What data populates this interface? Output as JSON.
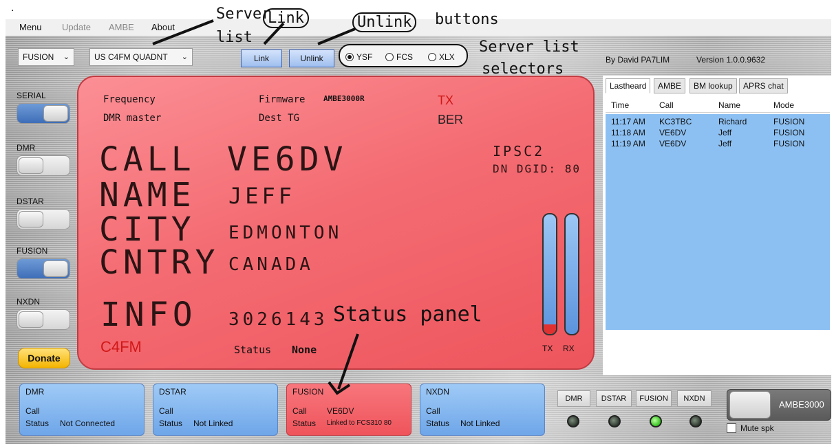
{
  "menu": {
    "items": [
      "Menu",
      "Update",
      "AMBE",
      "About"
    ]
  },
  "annotations": {
    "server_list": "Server",
    "server_list_2": "list",
    "link_box": "Link",
    "unlink_box": "Unlink",
    "buttons": "buttons",
    "selectors_1": "Server list",
    "selectors_2": "selectors",
    "status_panel": "Status panel"
  },
  "toolbar": {
    "mode": "FUSION",
    "server": "US C4FM QUADNT",
    "link_label": "Link",
    "unlink_label": "Unlink",
    "radios": [
      {
        "label": "YSF",
        "selected": true
      },
      {
        "label": "FCS",
        "selected": false
      },
      {
        "label": "XLX",
        "selected": false
      }
    ],
    "author": "By David PA7LIM",
    "version": "Version 1.0.0.9632"
  },
  "sidebar": {
    "toggles": [
      {
        "label": "SERIAL",
        "on": true
      },
      {
        "label": "DMR",
        "on": false
      },
      {
        "label": "DSTAR",
        "on": false
      },
      {
        "label": "FUSION",
        "on": true
      },
      {
        "label": "NXDN",
        "on": false
      }
    ],
    "donate": "Donate"
  },
  "display": {
    "frequency_label": "Frequency",
    "firmware_label": "Firmware",
    "firmware_value": "AMBE3000R",
    "tx": "TX",
    "dmr_master_label": "DMR master",
    "dest_tg_label": "Dest TG",
    "ber": "BER",
    "call_label": "CALL",
    "call_value": "VE6DV",
    "ipsc": "IPSC2",
    "dn_dgid": "DN DGID: 80",
    "name_label": "NAME",
    "name_value": "JEFF",
    "city_label": "CITY",
    "city_value": "EDMONTON",
    "cntry_label": "CNTRY",
    "cntry_value": "CANADA",
    "info_label": "INFO",
    "info_value": "3026143",
    "mode": "C4FM",
    "status_label": "Status",
    "status_value": "None",
    "tx_meter_label": "TX",
    "rx_meter_label": "RX",
    "tx_level": 0.08,
    "rx_level": 0.0
  },
  "right_panel": {
    "tabs": [
      "Lastheard",
      "AMBE",
      "BM lookup",
      "APRS chat"
    ],
    "columns": [
      "Time",
      "Call",
      "Name",
      "Mode"
    ],
    "rows": [
      [
        "11:17 AM",
        "KC3TBC",
        "Richard",
        "FUSION"
      ],
      [
        "11:18 AM",
        "VE6DV",
        "Jeff",
        "FUSION"
      ],
      [
        "11:19 AM",
        "VE6DV",
        "Jeff",
        "FUSION"
      ]
    ]
  },
  "status_panels": [
    {
      "title": "DMR",
      "call_label": "Call",
      "call_value": "",
      "status_label": "Status",
      "status_value": "Not Connected",
      "color": "#8ab9f0"
    },
    {
      "title": "DSTAR",
      "call_label": "Call",
      "call_value": "",
      "status_label": "Status",
      "status_value": "Not Linked",
      "color": "#8ab9f0"
    },
    {
      "title": "FUSION",
      "call_label": "Call",
      "call_value": "VE6DV",
      "status_label": "Status",
      "status_value": "Linked to FCS310 80",
      "color": "#f2646a"
    },
    {
      "title": "NXDN",
      "call_label": "Call",
      "call_value": "",
      "status_label": "Status",
      "status_value": "Not Linked",
      "color": "#8ab9f0"
    }
  ],
  "mode_indicators": [
    {
      "label": "DMR",
      "active": false
    },
    {
      "label": "DSTAR",
      "active": false
    },
    {
      "label": "FUSION",
      "active": true
    },
    {
      "label": "NXDN",
      "active": false
    }
  ],
  "ambe": {
    "label": "AMBE3000",
    "mute_label": "Mute spk"
  }
}
